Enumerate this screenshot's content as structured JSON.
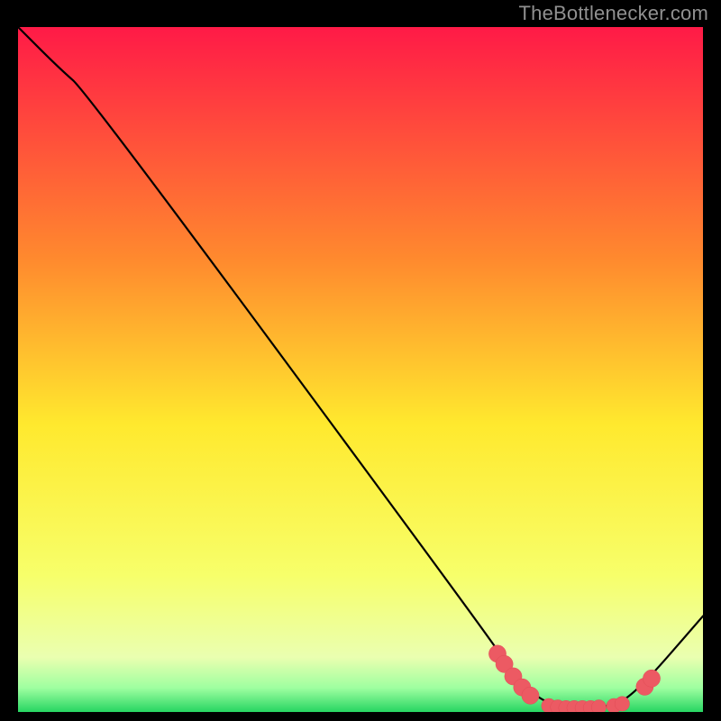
{
  "attribution": "TheBottlenecker.com",
  "colors": {
    "bg": "#000000",
    "curve": "#000000",
    "marker_fill": "#ec5a63",
    "marker_stroke": "#e24b55",
    "grad_top": "#ff1a47",
    "grad_mid_upper": "#ff8a2e",
    "grad_mid": "#ffe92e",
    "grad_mid_lower": "#f7ff6a",
    "grad_low": "#eaffb0",
    "grad_band": "#9effa0",
    "grad_bottom": "#27d562"
  },
  "chart_data": {
    "type": "line",
    "title": "",
    "xlabel": "",
    "ylabel": "",
    "xlim": [
      0,
      100
    ],
    "ylim": [
      0,
      100
    ],
    "curve": [
      {
        "x": 0,
        "y": 100
      },
      {
        "x": 6,
        "y": 94
      },
      {
        "x": 10,
        "y": 90.5
      },
      {
        "x": 68,
        "y": 12
      },
      {
        "x": 72,
        "y": 6
      },
      {
        "x": 76,
        "y": 1.8
      },
      {
        "x": 80,
        "y": 0.6
      },
      {
        "x": 86,
        "y": 0.6
      },
      {
        "x": 90,
        "y": 2.5
      },
      {
        "x": 100,
        "y": 14
      }
    ],
    "markers": [
      {
        "x": 70.0,
        "y": 8.5,
        "r": 1.4
      },
      {
        "x": 71.0,
        "y": 7.0,
        "r": 1.4
      },
      {
        "x": 72.3,
        "y": 5.2,
        "r": 1.4
      },
      {
        "x": 73.6,
        "y": 3.6,
        "r": 1.4
      },
      {
        "x": 74.8,
        "y": 2.4,
        "r": 1.4
      },
      {
        "x": 77.5,
        "y": 0.9,
        "r": 1.2
      },
      {
        "x": 78.8,
        "y": 0.7,
        "r": 1.2
      },
      {
        "x": 80.0,
        "y": 0.6,
        "r": 1.2
      },
      {
        "x": 81.2,
        "y": 0.6,
        "r": 1.2
      },
      {
        "x": 82.4,
        "y": 0.6,
        "r": 1.2
      },
      {
        "x": 83.6,
        "y": 0.6,
        "r": 1.2
      },
      {
        "x": 84.8,
        "y": 0.7,
        "r": 1.2
      },
      {
        "x": 87.0,
        "y": 0.9,
        "r": 1.2
      },
      {
        "x": 88.2,
        "y": 1.2,
        "r": 1.2
      },
      {
        "x": 91.5,
        "y": 3.7,
        "r": 1.4
      },
      {
        "x": 92.5,
        "y": 4.9,
        "r": 1.4
      }
    ]
  }
}
